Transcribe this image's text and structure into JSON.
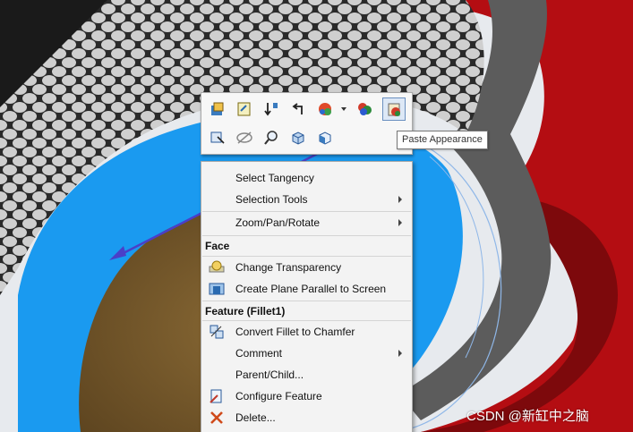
{
  "toolbar": {
    "row1": [
      {
        "icon": "edit-feature-icon"
      },
      {
        "icon": "edit-sketch-icon"
      },
      {
        "icon": "rollback-icon"
      },
      {
        "icon": "undo-arrow-icon"
      },
      {
        "icon": "appearances-icon"
      },
      {
        "icon": "appearance-options-icon"
      },
      {
        "icon": "paste-appearance-icon"
      }
    ],
    "row2": [
      {
        "icon": "select-other-icon"
      },
      {
        "icon": "hide-icon"
      },
      {
        "icon": "zoom-to-selection-icon"
      },
      {
        "icon": "normal-to-icon"
      },
      {
        "icon": "view-orientation-icon"
      }
    ]
  },
  "tooltip": {
    "text": "Paste Appearance"
  },
  "menu": {
    "items_top": [
      {
        "label": "Select Tangency",
        "has_submenu": false
      },
      {
        "label": "Selection Tools",
        "has_submenu": true
      },
      {
        "label": "Zoom/Pan/Rotate",
        "has_submenu": true
      }
    ],
    "face_header": "Face",
    "face_items": [
      {
        "label": "Change Transparency",
        "icon": "transparency-icon"
      },
      {
        "label": "Create Plane Parallel to Screen",
        "icon": "plane-parallel-icon"
      }
    ],
    "feature_header": "Feature (Fillet1)",
    "feature_items": [
      {
        "label": "Convert Fillet to Chamfer",
        "icon": "convert-fillet-icon",
        "has_submenu": false
      },
      {
        "label": "Comment",
        "icon": "",
        "has_submenu": true
      },
      {
        "label": "Parent/Child...",
        "icon": "",
        "has_submenu": false
      },
      {
        "label": "Configure Feature",
        "icon": "configure-feature-icon",
        "has_submenu": false
      },
      {
        "label": "Delete...",
        "icon": "delete-icon",
        "has_submenu": false
      }
    ]
  },
  "watermark": "CSDN @新缸中之脑",
  "colors": {
    "face_selected": "#1a9af0",
    "fillet_body": "#7a5a2a",
    "red_part": "#b40d12",
    "dark_ring": "#5a5a5a",
    "accent_arrow": "#4a3fc8"
  }
}
